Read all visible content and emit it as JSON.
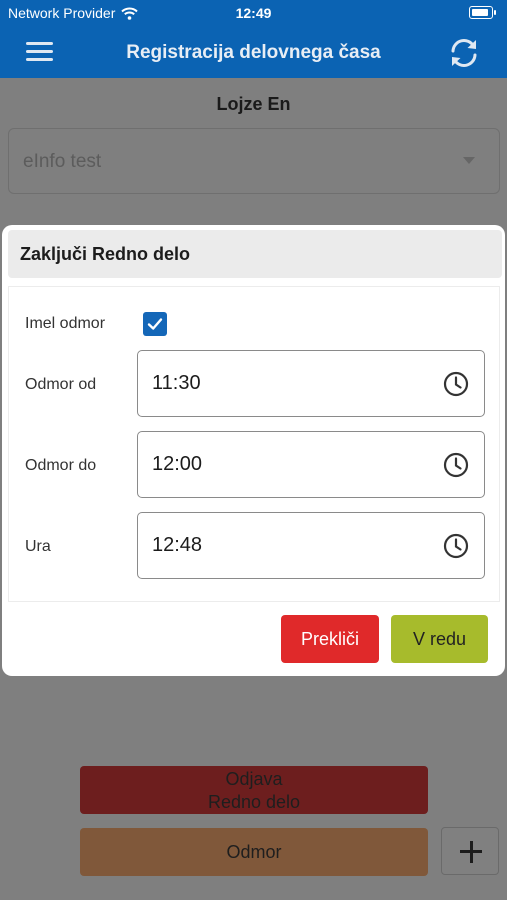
{
  "status_bar": {
    "carrier": "Network Provider",
    "time": "12:49"
  },
  "app_bar": {
    "title": "Registracija delovnega časa"
  },
  "main": {
    "user_name": "Lojze En",
    "project_select_value": "eInfo test",
    "checkout_button_line1": "Odjava",
    "checkout_button_line2": "Redno delo",
    "break_button": "Odmor"
  },
  "dialog": {
    "title": "Zaključi Redno delo",
    "had_break_label": "Imel odmor",
    "had_break_checked": true,
    "break_from_label": "Odmor od",
    "break_from_value": "11:30",
    "break_to_label": "Odmor do",
    "break_to_value": "12:00",
    "time_label": "Ura",
    "time_value": "12:48",
    "cancel_label": "Prekliči",
    "ok_label": "V redu"
  },
  "colors": {
    "app_bar": "#0b63b3",
    "cancel": "#e0292a",
    "ok": "#a7bb2c",
    "checkbox": "#1467b8"
  },
  "icons": [
    "wifi-icon",
    "battery-icon",
    "menu-icon",
    "refresh-icon",
    "chevron-down-icon",
    "checkmark-icon",
    "clock-icon",
    "plus-icon"
  ]
}
